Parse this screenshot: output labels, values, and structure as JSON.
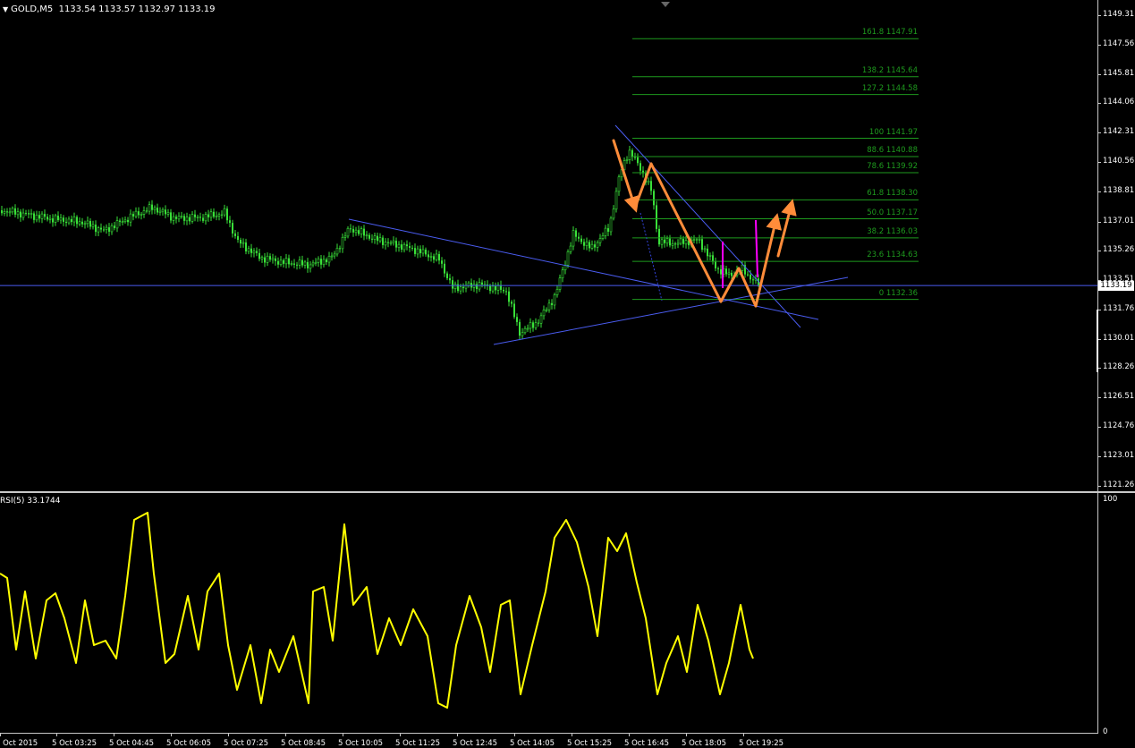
{
  "header": {
    "symbol": "GOLD,M5",
    "ohlc": "1133.54 1133.57 1132.97 1133.19",
    "menu_icon": "triangle-down-icon"
  },
  "price_axis": {
    "ticks": [
      "1149.31",
      "1147.56",
      "1145.81",
      "1144.06",
      "1142.31",
      "1140.56",
      "1138.81",
      "1137.01",
      "1135.26",
      "1133.51",
      "1131.76",
      "1130.01",
      "1128.26",
      "1126.51",
      "1124.76",
      "1123.01",
      "1121.26"
    ],
    "current_price": "1133.19"
  },
  "fibonacci": {
    "levels": [
      {
        "label": "161.8 1147.91",
        "price": 1147.91
      },
      {
        "label": "138.2 1145.64",
        "price": 1145.64
      },
      {
        "label": "127.2 1144.58",
        "price": 1144.58
      },
      {
        "label": "100 1141.97",
        "price": 1141.97
      },
      {
        "label": "88.6 1140.88",
        "price": 1140.88
      },
      {
        "label": "78.6 1139.92",
        "price": 1139.92
      },
      {
        "label": "61.8 1138.30",
        "price": 1138.3
      },
      {
        "label": "50.0 1137.17",
        "price": 1137.17
      },
      {
        "label": "38.2 1136.03",
        "price": 1136.03
      },
      {
        "label": "23.6 1134.63",
        "price": 1134.63
      },
      {
        "label": "0 1132.36",
        "price": 1132.36
      }
    ]
  },
  "rsi": {
    "title": "RSI(5) 33.1744",
    "scale_top": "100",
    "scale_bottom": "0"
  },
  "time_axis": {
    "labels": [
      "2 Oct 2015",
      "5 Oct 03:25",
      "5 Oct 04:45",
      "5 Oct 06:05",
      "5 Oct 07:25",
      "5 Oct 08:45",
      "5 Oct 10:05",
      "5 Oct 11:25",
      "5 Oct 12:45",
      "5 Oct 14:05",
      "5 Oct 15:25",
      "5 Oct 16:45",
      "5 Oct 18:05",
      "5 Oct 19:25"
    ]
  },
  "colors": {
    "candles": "#39e039",
    "fib": "#1e9a1e",
    "trendline": "#4a5cf0",
    "arrows": "#ff8c3a",
    "magenta": "#ff00ff",
    "rsi": "#ffff00"
  }
}
